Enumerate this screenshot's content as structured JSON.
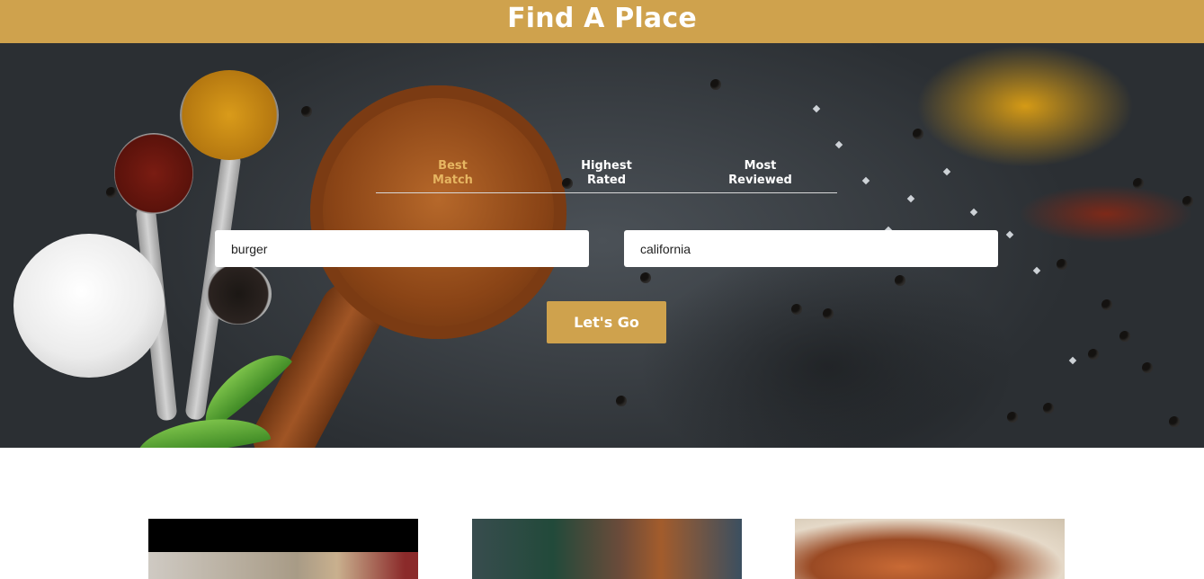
{
  "header": {
    "title": "Find A Place"
  },
  "sort_tabs": [
    {
      "line1": "Best",
      "line2": "Match",
      "active": true
    },
    {
      "line1": "Highest",
      "line2": "Rated",
      "active": false
    },
    {
      "line1": "Most",
      "line2": "Reviewed",
      "active": false
    }
  ],
  "search": {
    "term_value": "burger",
    "location_value": "california"
  },
  "submit": {
    "label": "Let's Go"
  },
  "colors": {
    "brand": "#cfa24d",
    "active_tab": "#e6b561",
    "text_light": "#ffffff"
  },
  "results": [
    {
      "image_icon": "business-photo"
    },
    {
      "image_icon": "business-photo"
    },
    {
      "image_icon": "business-photo"
    }
  ]
}
